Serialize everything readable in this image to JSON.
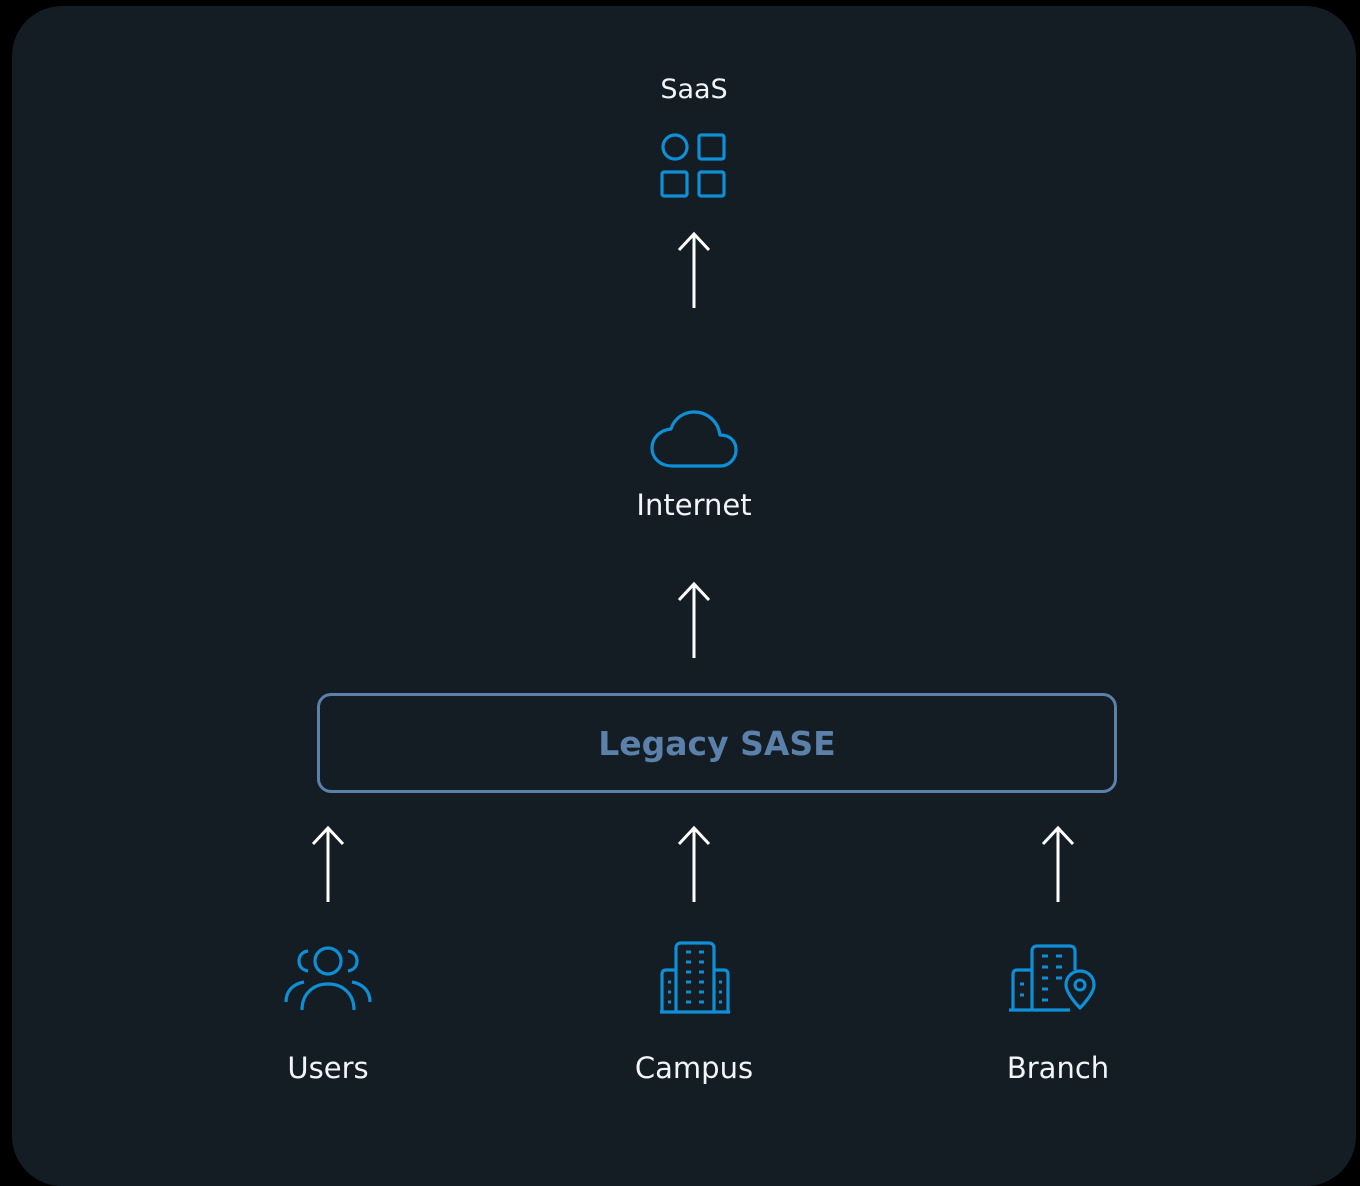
{
  "diagram": {
    "saas": {
      "label": "SaaS",
      "icon": "apps-grid-icon"
    },
    "internet": {
      "label": "Internet",
      "icon": "cloud-icon"
    },
    "legacy_sase": {
      "label": "Legacy SASE"
    },
    "sources": [
      {
        "label": "Users",
        "icon": "users-group-icon"
      },
      {
        "label": "Campus",
        "icon": "campus-buildings-icon"
      },
      {
        "label": "Branch",
        "icon": "branch-building-location-icon"
      }
    ],
    "colors": {
      "background": "#000000",
      "panel": "#141c24",
      "icon_accent": "#0f8fd6",
      "sase_border": "#5b80aa",
      "text": "#f2f4f8",
      "arrow": "#ffffff"
    }
  }
}
